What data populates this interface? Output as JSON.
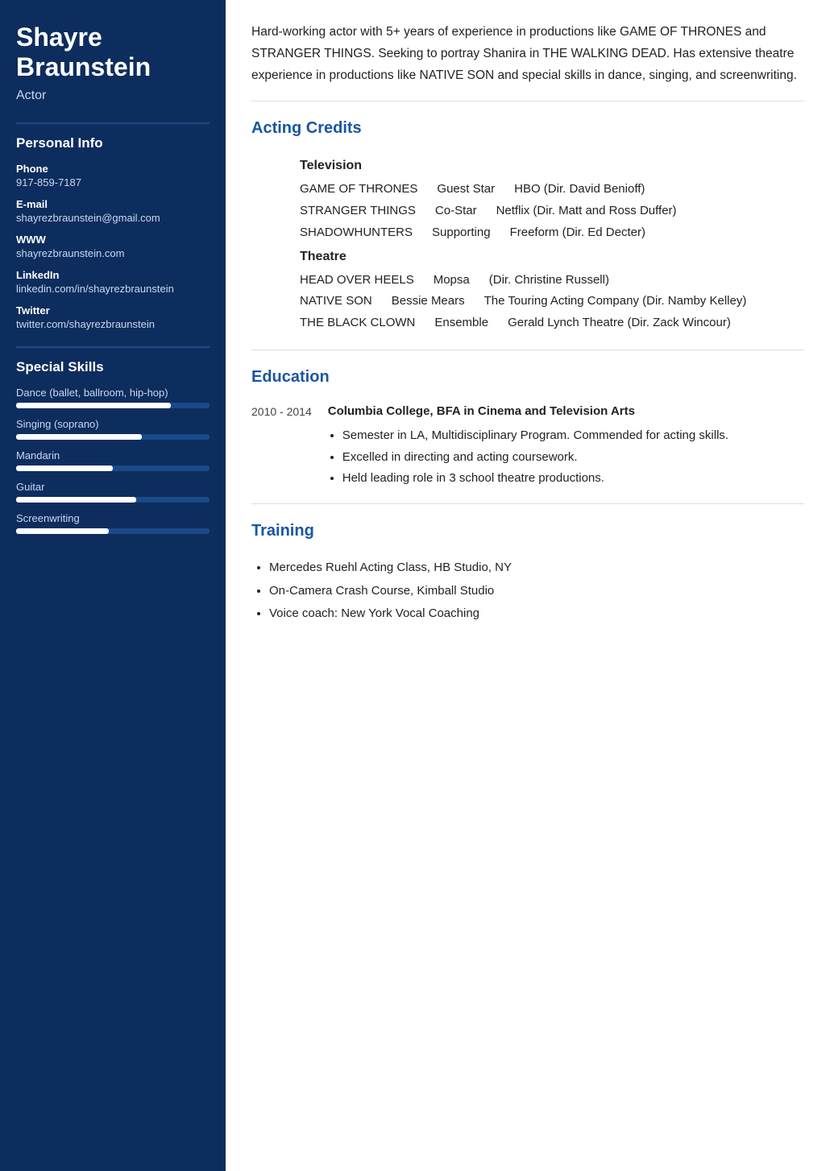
{
  "sidebar": {
    "name": "Shayre Braunstein",
    "title": "Actor",
    "personal_info_title": "Personal Info",
    "contacts": [
      {
        "label": "Phone",
        "value": "917-859-7187"
      },
      {
        "label": "E-mail",
        "value": "shayrezbraunstein@gmail.com"
      },
      {
        "label": "WWW",
        "value": "shayrezbraunstein.com"
      },
      {
        "label": "LinkedIn",
        "value": "linkedin.com/in/shayrezbraunstein"
      },
      {
        "label": "Twitter",
        "value": "twitter.com/shayrezbraunstein"
      }
    ],
    "skills_title": "Special Skills",
    "skills": [
      {
        "name": "Dance (ballet, ballroom, hip-hop)",
        "percent": 80
      },
      {
        "name": "Singing (soprano)",
        "percent": 65
      },
      {
        "name": "Mandarin",
        "percent": 50
      },
      {
        "name": "Guitar",
        "percent": 62
      },
      {
        "name": "Screenwriting",
        "percent": 48
      }
    ]
  },
  "main": {
    "summary": "Hard-working actor with 5+ years of experience in productions like GAME OF THRONES and STRANGER THINGS. Seeking to portray Shanira in THE WALKING DEAD. Has extensive theatre experience in productions like NATIVE SON and special skills in dance, singing, and screenwriting.",
    "acting_credits_title": "Acting Credits",
    "categories": [
      {
        "category": "Television",
        "credits": [
          {
            "show": "GAME OF THRONES",
            "role": "Guest Star",
            "company": "HBO (Dir. David Benioff)"
          },
          {
            "show": "STRANGER THINGS",
            "role": "Co-Star",
            "company": "Netflix (Dir. Matt and Ross Duffer)"
          },
          {
            "show": "SHADOWHUNTERS",
            "role": "Supporting",
            "company": "Freeform (Dir. Ed Decter)"
          }
        ]
      },
      {
        "category": "Theatre",
        "credits": [
          {
            "show": "HEAD OVER HEELS",
            "role": "Mopsa",
            "company": "(Dir. Christine Russell)"
          },
          {
            "show": "NATIVE SON",
            "role": "Bessie Mears",
            "company": "The Touring Acting Company (Dir. Namby Kelley)"
          },
          {
            "show": "THE BLACK CLOWN",
            "role": "Ensemble",
            "company": "Gerald Lynch Theatre (Dir. Zack Wincour)"
          }
        ]
      }
    ],
    "education_title": "Education",
    "education": [
      {
        "years": "2010 - 2014",
        "school": "Columbia College, BFA in Cinema and Television Arts",
        "bullets": [
          "Semester in LA, Multidisciplinary Program. Commended for acting skills.",
          "Excelled in directing and acting coursework.",
          "Held leading role in 3 school theatre productions."
        ]
      }
    ],
    "training_title": "Training",
    "training": [
      "Mercedes Ruehl Acting Class, HB Studio, NY",
      "On-Camera Crash Course, Kimball Studio",
      "Voice coach: New York Vocal Coaching"
    ]
  }
}
